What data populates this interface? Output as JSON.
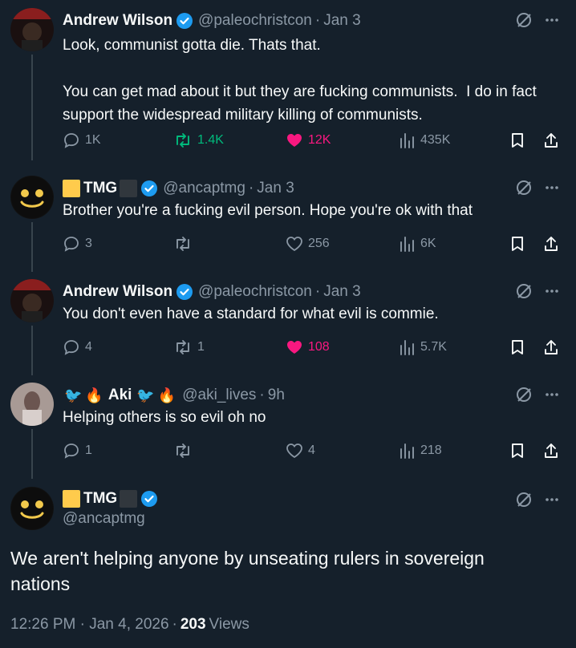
{
  "colors": {
    "background": "#15202b",
    "text": "#f7f9f9",
    "muted": "#8b98a5",
    "verified": "#1d9bf0",
    "repost_active": "#00ba7c",
    "like_active": "#f91880"
  },
  "replies": [
    {
      "name": "Andrew Wilson",
      "handle": "@paleochristcon",
      "time": "Jan 3",
      "text": "Look, communist gotta die. Thats that.\n\nYou can get mad about it but they are fucking communists.  I do in fact support the widespread military killing of communists.",
      "replies": "1K",
      "reposts": "1.4K",
      "likes": "12K",
      "views": "435K"
    },
    {
      "name": "TMG",
      "handle": "@ancaptmg",
      "time": "Jan 3",
      "text": "Brother you're a fucking evil person. Hope you're ok with that",
      "replies": "3",
      "reposts": "",
      "likes": "256",
      "views": "6K"
    },
    {
      "name": "Andrew Wilson",
      "handle": "@paleochristcon",
      "time": "Jan 3",
      "text": "You don't even have a standard for what evil is commie.",
      "replies": "4",
      "reposts": "1",
      "likes": "108",
      "views": "5.7K"
    },
    {
      "name": "Aki",
      "handle": "@aki_lives",
      "time": "9h",
      "text": "Helping others is so evil oh no",
      "replies": "1",
      "reposts": "",
      "likes": "4",
      "views": "218"
    }
  ],
  "main_post": {
    "name": "TMG",
    "handle": "@ancaptmg",
    "text": "We aren't helping anyone by unseating rulers in sovereign nations",
    "timestamp": "12:26 PM · Jan 4, 2026",
    "views_count": "203",
    "views_label": "Views"
  },
  "icons": {
    "reply": "reply-icon",
    "repost": "repost-icon",
    "like": "heart-icon",
    "views": "views-icon",
    "bookmark": "bookmark-icon",
    "share": "share-icon",
    "grok": "grok-icon",
    "more": "more-icon",
    "verified": "verified-badge-icon"
  }
}
